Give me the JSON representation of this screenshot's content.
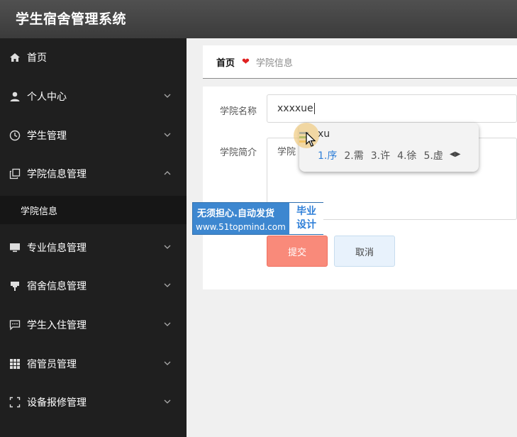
{
  "app": {
    "title": "学生宿舍管理系统"
  },
  "sidebar": {
    "items": [
      {
        "label": "首页",
        "icon": "home-icon"
      },
      {
        "label": "个人中心",
        "icon": "user-icon"
      },
      {
        "label": "学生管理",
        "icon": "clock-icon"
      },
      {
        "label": "学院信息管理",
        "icon": "copy-icon"
      },
      {
        "label": "专业信息管理",
        "icon": "monitor-icon"
      },
      {
        "label": "宿舍信息管理",
        "icon": "pin-icon"
      },
      {
        "label": "学生入住管理",
        "icon": "chat-icon"
      },
      {
        "label": "宿管员管理",
        "icon": "grid-icon"
      },
      {
        "label": "设备报修管理",
        "icon": "fullscreen-icon"
      }
    ],
    "sub_item": {
      "label": "学院信息"
    }
  },
  "breadcrumb": {
    "home": "首页",
    "current": "学院信息"
  },
  "form": {
    "name_label": "学院名称",
    "name_value": "xxxxue",
    "intro_label": "学院简介",
    "intro_value": "学院",
    "submit_label": "提交",
    "cancel_label": "取消"
  },
  "ime": {
    "composition": "xu",
    "candidates": [
      "1.序",
      "2.需",
      "3.许",
      "4.徐",
      "5.虚"
    ]
  },
  "watermark": {
    "line1": "无须担心.自动发货",
    "line2": "www.51topmind.com",
    "box_line1": "毕业",
    "box_line2": "设计"
  },
  "colors": {
    "accent_submit": "#f98a7a",
    "cancel_bg": "#e8f2fc",
    "sidebar_bg": "#1f1f1f"
  }
}
